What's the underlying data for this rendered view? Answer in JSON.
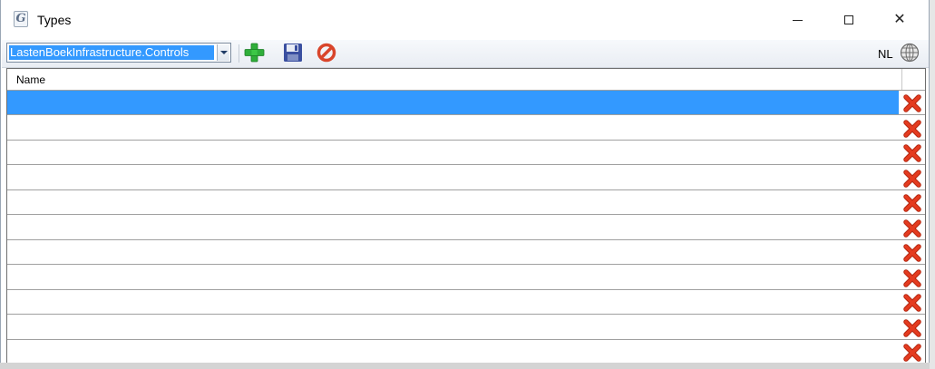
{
  "window": {
    "title": "Types",
    "app_icon_glyph": "G",
    "controls": {
      "minimize_icon": "minimize-icon",
      "maximize_icon": "maximize-icon",
      "close_icon": "close-icon",
      "close_glyph": "✕"
    }
  },
  "toolbar": {
    "type_selector": {
      "value": "LastenBoekInfrastructure.Controls"
    },
    "buttons": [
      {
        "name": "add-button",
        "icon": "plus-icon",
        "color": "#2fae3a"
      },
      {
        "name": "save-button",
        "icon": "floppy-disk-icon",
        "color": "#3a4fa0"
      },
      {
        "name": "cancel-button",
        "icon": "no-entry-icon",
        "color": "#d9452b"
      }
    ],
    "language": "NL",
    "language_icon": "globe-icon"
  },
  "grid": {
    "columns": [
      {
        "label": "Name"
      }
    ],
    "rows": [
      {
        "name": "",
        "selected": true
      },
      {
        "name": "",
        "selected": false
      },
      {
        "name": "",
        "selected": false
      },
      {
        "name": "",
        "selected": false
      },
      {
        "name": "",
        "selected": false
      },
      {
        "name": "",
        "selected": false
      },
      {
        "name": "",
        "selected": false
      },
      {
        "name": "",
        "selected": false
      },
      {
        "name": "",
        "selected": false
      },
      {
        "name": "",
        "selected": false
      },
      {
        "name": "",
        "selected": false
      }
    ],
    "row_delete_icon": "red-x-delete-icon"
  },
  "colors": {
    "selection": "#3399ff",
    "delete_red": "#e53b1f",
    "border": "#6f6f6f"
  }
}
